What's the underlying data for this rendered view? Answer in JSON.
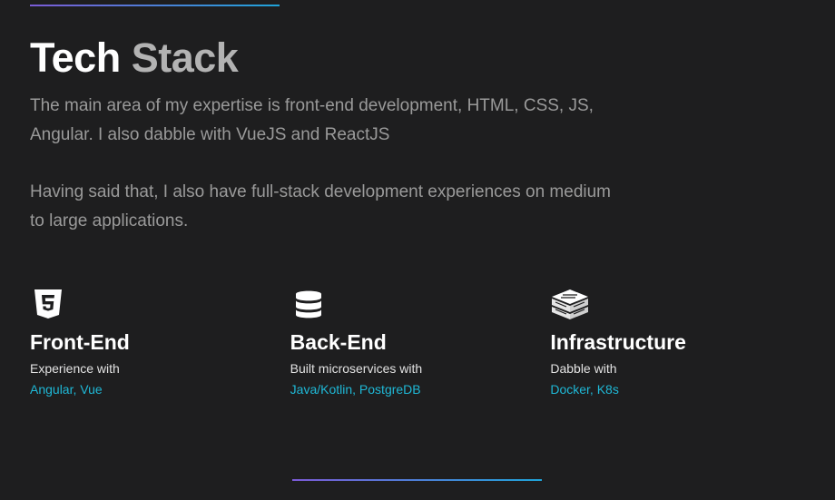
{
  "section": {
    "title_part1": "Tech",
    "title_part2": "Stack",
    "paragraph1": "The main area of my expertise is front-end development, HTML, CSS, JS, Angular. I also dabble with VueJS and ReactJS",
    "paragraph2": "Having said that, I also have full-stack development experiences on medium to large applications."
  },
  "cards": [
    {
      "icon": "html5-icon",
      "title": "Front-End",
      "intro": "Experience with",
      "tech": "Angular, Vue"
    },
    {
      "icon": "database-icon",
      "title": "Back-End",
      "intro": "Built microservices with",
      "tech": "Java/Kotlin, PostgreDB"
    },
    {
      "icon": "server-stack-icon",
      "title": "Infrastructure",
      "intro": "Dabble with",
      "tech": "Docker, K8s"
    }
  ],
  "colors": {
    "background": "#1e1e1f",
    "accent": "#1fb8d6",
    "gradient_start": "#7b5bd6",
    "gradient_end": "#1fa3d8"
  }
}
